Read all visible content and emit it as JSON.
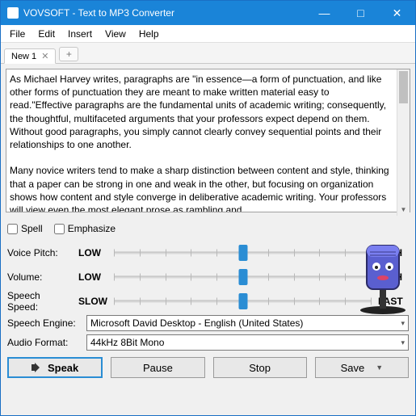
{
  "window": {
    "title": "VOVSOFT - Text to MP3 Converter"
  },
  "menu": {
    "file": "File",
    "edit": "Edit",
    "insert": "Insert",
    "view": "View",
    "help": "Help"
  },
  "tabs": {
    "active": "New 1"
  },
  "document_text": "As Michael Harvey writes, paragraphs are \"in essence—a form of punctuation, and like other forms of punctuation they are meant to make written material easy to read.\"Effective paragraphs are the fundamental units of academic writing; consequently, the thoughtful, multifaceted arguments that your professors expect depend on them. Without good paragraphs, you simply cannot clearly convey sequential points and their relationships to one another.\n\nMany novice writers tend to make a sharp distinction between content and style, thinking that a paper can be strong in one and weak in the other, but focusing on organization shows how content and style converge in deliberative academic writing. Your professors will view even the most elegant prose as rambling and",
  "options": {
    "spell": "Spell",
    "emphasize": "Emphasize"
  },
  "sliders": {
    "pitch": {
      "label": "Voice Pitch:",
      "low": "LOW",
      "high": "HIGH"
    },
    "volume": {
      "label": "Volume:",
      "low": "LOW",
      "high": "HIGH"
    },
    "speed": {
      "label": "Speech Speed:",
      "low": "SLOW",
      "high": "FAST"
    }
  },
  "selects": {
    "engine_label": "Speech Engine:",
    "engine_value": "Microsoft David Desktop - English (United States)",
    "format_label": "Audio Format:",
    "format_value": "44kHz 8Bit Mono"
  },
  "buttons": {
    "speak": "Speak",
    "pause": "Pause",
    "stop": "Stop",
    "save": "Save"
  }
}
